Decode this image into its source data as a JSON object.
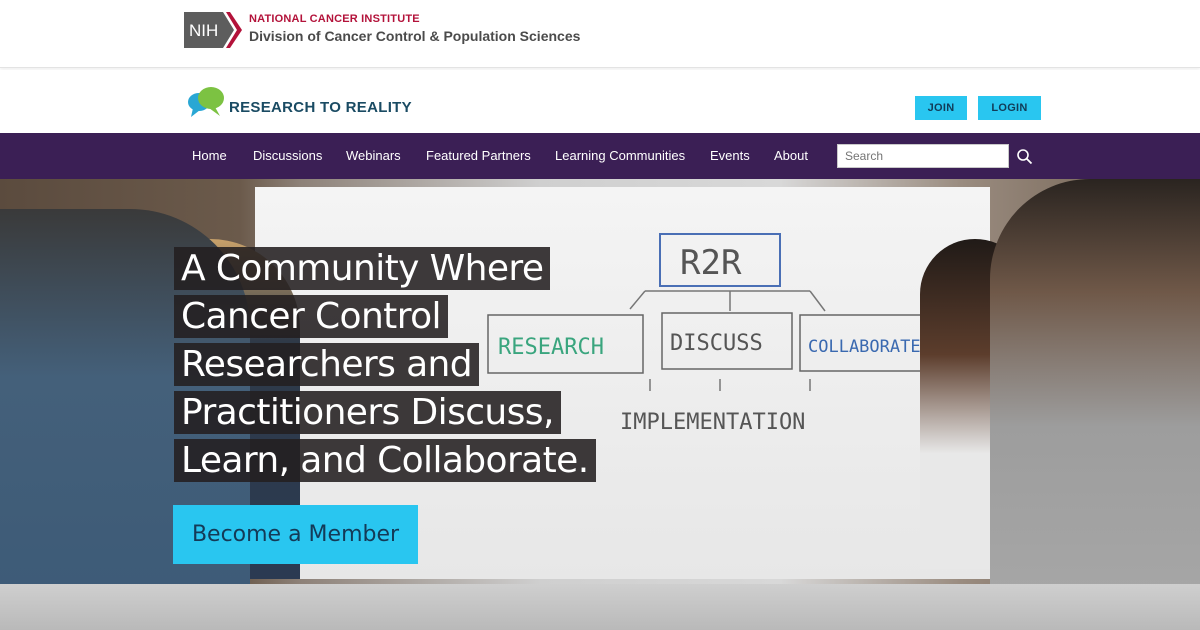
{
  "nih": {
    "logo_text": "NIH",
    "institute": "NATIONAL CANCER INSTITUTE",
    "division": "Division of Cancer Control & Population Sciences"
  },
  "brand": {
    "name": "RESEARCH TO REALITY",
    "join_label": "JOIN",
    "login_label": "LOGIN"
  },
  "nav": {
    "items": [
      "Home",
      "Discussions",
      "Webinars",
      "Featured Partners",
      "Learning Communities",
      "Events",
      "About"
    ],
    "search_placeholder": "Search"
  },
  "hero": {
    "headline_lines": [
      "A Community Where",
      "Cancer Control",
      "Researchers and",
      "Practitioners Discuss,",
      "Learn, and Collaborate."
    ],
    "cta_label": "Become a Member",
    "whiteboard": {
      "title": "R2R",
      "boxes": [
        "RESEARCH",
        "DISCUSS",
        "COLLABORATE"
      ],
      "bottom": "IMPLEMENTATION"
    }
  },
  "colors": {
    "nih_red": "#b3123a",
    "brand_navy": "#1a4b63",
    "accent_cyan": "#29c6f0",
    "nav_purple": "#3b1f55"
  }
}
